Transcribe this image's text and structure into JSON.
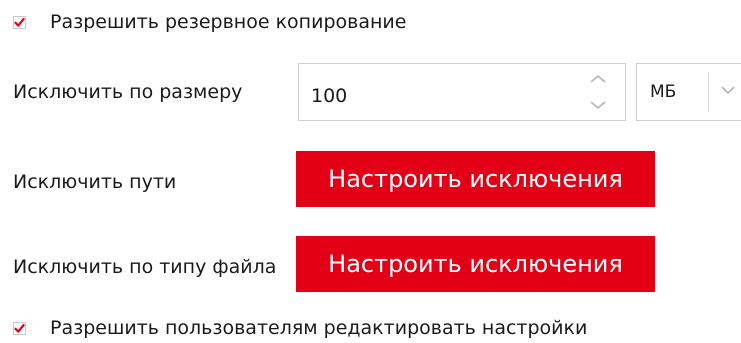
{
  "colors": {
    "accent": "#e30016",
    "check_mark": "#e30016",
    "border": "#cfcfcf",
    "text": "#1a1a1a"
  },
  "allow_backup": {
    "checked": true,
    "label": "Разрешить резервное копирование"
  },
  "exclude_by_size": {
    "label": "Исключить по размеру",
    "value": "100",
    "unit": "МБ"
  },
  "exclude_paths": {
    "label": "Исключить пути",
    "button_label": "Настроить исключения"
  },
  "exclude_by_type": {
    "label": "Исключить по типу файла",
    "button_label": "Настроить исключения"
  },
  "allow_user_edit": {
    "checked": true,
    "label": "Разрешить пользователям редактировать настройки"
  }
}
